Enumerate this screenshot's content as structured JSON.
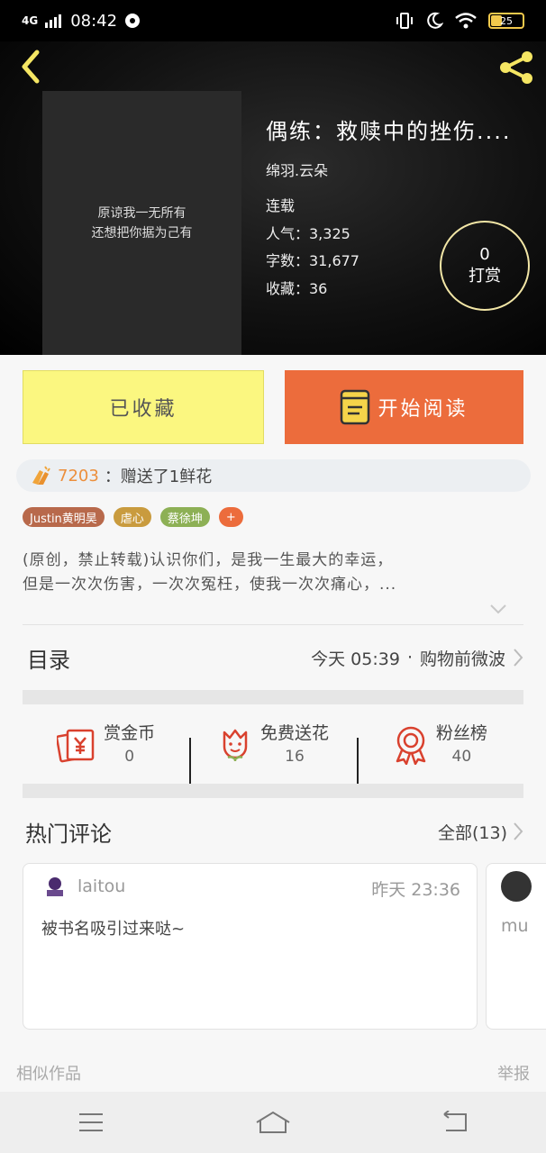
{
  "status_bar": {
    "network": "4G",
    "time": "08:42",
    "battery": "25"
  },
  "book": {
    "cover_lines": [
      "原谅我一无所有",
      "还想把你据为己有"
    ],
    "title": "偶练：救赎中的挫伤....",
    "author": "绵羽.云朵",
    "status": "连载",
    "popularity": "人气：3,325",
    "word_count": "字数：31,677",
    "favorites": "收藏：36"
  },
  "tip": {
    "count": "0",
    "label": "打赏"
  },
  "actions": {
    "collect_label": "已收藏",
    "read_label": "开始阅读"
  },
  "gift": {
    "user": "7203",
    "text": "：赠送了1鲜花"
  },
  "tags": [
    {
      "label": "Justin黄明昊",
      "color": "#b8694b"
    },
    {
      "label": "虐心",
      "color": "#c99b3e"
    },
    {
      "label": "蔡徐坤",
      "color": "#8db055"
    },
    {
      "label": "+",
      "color": "#ec6c3c"
    }
  ],
  "intro": [
    "(原创，禁止转载)认识你们，是我一生最大的幸运，",
    "但是一次次伤害，一次次冤枉，使我一次次痛心，..."
  ],
  "catalog": {
    "label": "目录",
    "latest_time": "今天 05:39",
    "separator": "·",
    "latest_chapter": "购物前微波"
  },
  "stats": [
    {
      "label": "赏金币",
      "value": "0",
      "icon": "coin-card-icon"
    },
    {
      "label": "免费送花",
      "value": "16",
      "icon": "flower-icon"
    },
    {
      "label": "粉丝榜",
      "value": "40",
      "icon": "medal-icon"
    }
  ],
  "comments": {
    "label": "热门评论",
    "all_label": "全部(13)",
    "items": [
      {
        "user": "laitou",
        "time": "昨天 23:36",
        "content": "被书名吸引过来哒~"
      },
      {
        "user": "mu"
      }
    ]
  },
  "footer": {
    "similar": "相似作品",
    "report": "举报"
  },
  "colors": {
    "accent_orange": "#ec6c3c",
    "collect_yellow": "#fbf780",
    "icon_red": "#d9412e",
    "header_icon_yellow": "#f5e663"
  }
}
